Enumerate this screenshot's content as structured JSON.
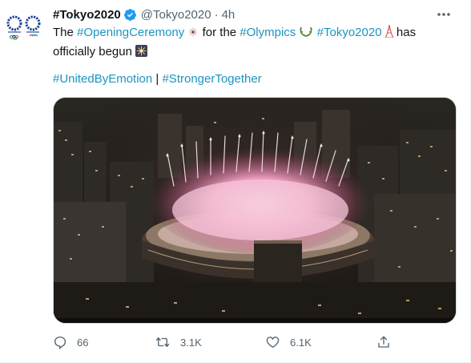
{
  "tweet": {
    "display_name": "#Tokyo2020",
    "handle": "@Tokyo2020",
    "separator": "·",
    "time": "4h",
    "text": {
      "p1": "The ",
      "tag_opening": "#OpeningCeremony",
      "p2": " for the ",
      "tag_olympics": "#Olympics",
      "tag_tokyo": "#Tokyo2020",
      "p3": " has",
      "p4": "officially begun"
    },
    "hashtags": {
      "united": "#UnitedByEmotion",
      "bar": " | ",
      "stronger": "#StrongerTogether"
    },
    "media": {
      "kind": "photo",
      "subject": "fireworks over stadium at night"
    },
    "actions": {
      "replies": "66",
      "retweets": "3.1K",
      "likes": "6.1K"
    }
  },
  "colors": {
    "link": "#1b95c0",
    "secondary_text": "#536471",
    "verified": "#1d9bf0",
    "olympic_blue": "#1c3f94"
  },
  "icons": [
    "verified-badge-icon",
    "more-icon",
    "reply-icon",
    "retweet-icon",
    "like-icon",
    "share-icon",
    "sparkler-emoji",
    "olive-wreath-emoji",
    "tower-emoji",
    "union-flag-emoji",
    "fireworks-emoji"
  ]
}
